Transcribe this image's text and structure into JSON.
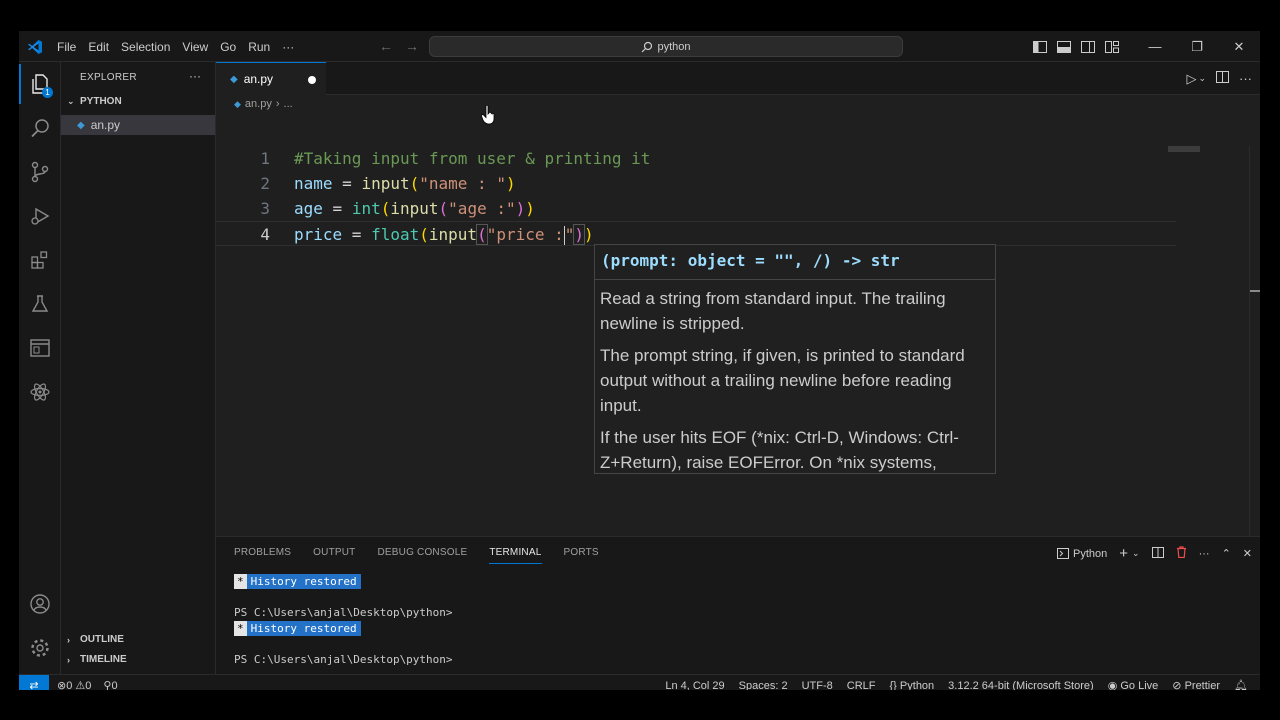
{
  "menu": [
    "File",
    "Edit",
    "Selection",
    "View",
    "Go",
    "Run",
    "···"
  ],
  "command_center": "python",
  "sidebar": {
    "title": "EXPLORER",
    "more": "···",
    "folder": "PYTHON",
    "file": "an.py",
    "outline": "OUTLINE",
    "timeline": "TIMELINE",
    "badge": "1"
  },
  "tab": {
    "label": "an.py"
  },
  "breadcrumb": {
    "file": "an.py",
    "sep": "›",
    "rest": "..."
  },
  "code": {
    "line_numbers": [
      "1",
      "2",
      "3",
      "4"
    ],
    "l1": "#Taking input from user & printing it",
    "l2": {
      "var": "name",
      "eq": " = ",
      "fn": "input",
      "open": "(",
      "str": "\"name : \"",
      "close": ")"
    },
    "l3": {
      "var": "age",
      "eq": " = ",
      "cls": "int",
      "open1": "(",
      "fn": "input",
      "open2": "(",
      "str": "\"age :\"",
      "close2": ")",
      "close1": ")"
    },
    "l4": {
      "var": "price",
      "eq": " = ",
      "cls": "float",
      "open1": "(",
      "fn": "input",
      "open2": "(",
      "str1": "\"price :",
      "str2": "\"",
      "close2": ")",
      "close1": ")"
    }
  },
  "hover": {
    "signature": "(prompt: object = \"\", /) -> str",
    "p1": "Read a string from standard input. The trailing newline is stripped.",
    "p2": "The prompt string, if given, is printed to standard output without a trailing newline before reading input.",
    "p3": "If the user hits EOF (*nix: Ctrl-D, Windows: Ctrl-Z+Return), raise EOFError. On *nix systems,"
  },
  "panel": {
    "tabs": [
      "PROBLEMS",
      "OUTPUT",
      "DEBUG CONSOLE",
      "TERMINAL",
      "PORTS"
    ],
    "active_tab": "TERMINAL",
    "terminal_name": "Python",
    "lines": {
      "hist_star": "*",
      "hist": "History restored",
      "prompt": "PS C:\\Users\\anjal\\Desktop\\python>"
    }
  },
  "status": {
    "errors": "0",
    "warnings": "0",
    "ports": "0",
    "position": "Ln 4, Col 29",
    "spaces": "Spaces: 2",
    "encoding": "UTF-8",
    "eol": "CRLF",
    "language": "Python",
    "interpreter": "3.12.2 64-bit (Microsoft Store)",
    "golive": "Go Live",
    "prettier": "Prettier"
  },
  "colors": {
    "accent": "#0078d4",
    "editor_bg": "#1f1f1f",
    "chrome_bg": "#181818"
  }
}
